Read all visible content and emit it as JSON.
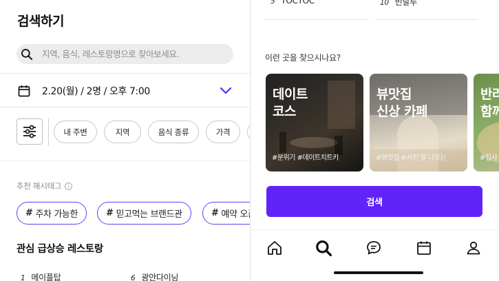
{
  "left": {
    "title": "검색하기",
    "search_placeholder": "지역, 음식, 레스토랑명으로 찾아보세요.",
    "date_selection": "2.20(월) / 2명 / 오후 7:00",
    "chips": [
      "내 주변",
      "지역",
      "음식 종류",
      "가격"
    ],
    "hashtag_section_label": "추천 해시태그",
    "hashtags": [
      "주차 가능한",
      "믿고먹는 브랜드관",
      "예약 오픈"
    ],
    "hot_title": "관심 급상승 레스토랑",
    "hot_items": [
      {
        "rank": "1",
        "name": "메이플탑"
      },
      {
        "rank": "6",
        "name": "광안다이닝"
      }
    ]
  },
  "right": {
    "top_ranks": [
      {
        "rank": "5",
        "name": "TOCTOC"
      },
      {
        "rank": "10",
        "name": "빈달루"
      }
    ],
    "question_title": "이런 곳을 찾으시나요?",
    "cards": [
      {
        "title": "데이트\n코스",
        "subtitle": "#분위기 #데이트치트키"
      },
      {
        "title": "뷰맛집\n신상 카페",
        "subtitle": "#뷰맛집 #사진 잘 나오는"
      },
      {
        "title": "반려\n함께",
        "subtitle": "#집사"
      }
    ],
    "search_button": "검색"
  },
  "tabbar": {
    "icons": [
      "home-icon",
      "search-icon",
      "chat-icon",
      "calendar-icon",
      "profile-icon"
    ],
    "active": "search-icon"
  },
  "colors": {
    "accent": "#6123f8",
    "tag_border": "#6b3cf5"
  }
}
